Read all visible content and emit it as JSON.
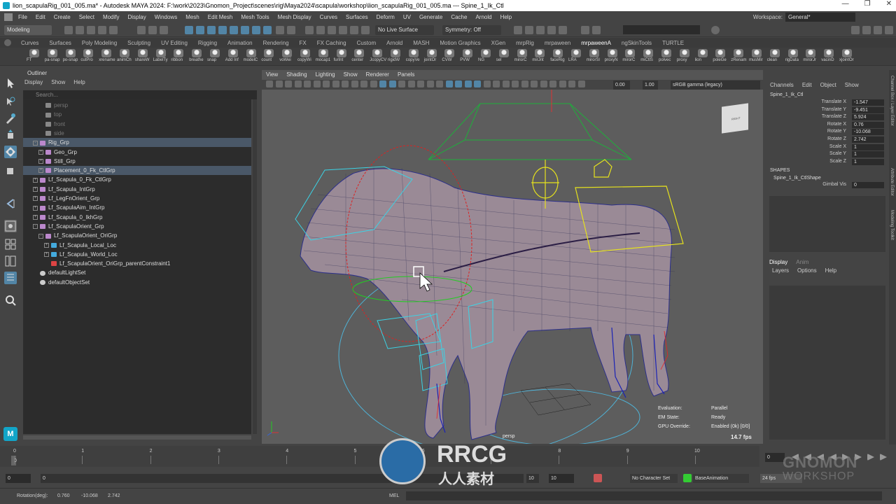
{
  "window": {
    "title": "lion_scapulaRig_001_005.ma* - Autodesk MAYA 2024: F:\\work\\2023\\Gnomon_Project\\scenes\\rig\\Maya2024\\scapula\\workshop\\lion_scapulaRig_001_005.ma  ---  Spine_1_Ik_Ctl",
    "controls": [
      "—",
      "❐",
      "✕"
    ]
  },
  "menubar": {
    "items": [
      "File",
      "Edit",
      "Create",
      "Select",
      "Modify",
      "Display",
      "Windows",
      "Mesh",
      "Edit Mesh",
      "Mesh Tools",
      "Mesh Display",
      "Curves",
      "Surfaces",
      "Deform",
      "UV",
      "Generate",
      "Cache",
      "Arnold",
      "Help"
    ],
    "workspace_label": "Workspace:",
    "workspace_value": "General*"
  },
  "statusline": {
    "mode": "Modeling",
    "live_surface": "No Live Surface",
    "symmetry": "Symmetry: Off"
  },
  "shelf_tabs": [
    "Curves",
    "Surfaces",
    "Poly Modeling",
    "Sculpting",
    "UV Editing",
    "Rigging",
    "Animation",
    "Rendering",
    "FX",
    "FX Caching",
    "Custom",
    "Arnold",
    "MASH",
    "Motion Graphics",
    "XGen",
    "mrpRig",
    "mrpaween",
    "mrpaweenA",
    "ngSkinTools",
    "TURTLE"
  ],
  "shelf_active": "mrpaweenA",
  "shelf_items": [
    "FT",
    "pa-snap",
    "po-snap",
    "cutPro",
    "xrename",
    "animCh",
    "shareW",
    "LabelTy",
    "ribbon",
    "breathe",
    "snap",
    "Add Inf",
    "modelC",
    "count",
    "voWei",
    "copyWi",
    "mocap1",
    "furInt",
    "center",
    "JcopyCV",
    "rigidW",
    "copyVe",
    "jointOr",
    "CVW",
    "PVW",
    "NG",
    "sel",
    "mirorC",
    "mirJnt",
    "faceRig",
    "LRA",
    "mirorSl",
    "proxyN",
    "mirorC",
    "miCtlS",
    "polvec",
    "proxy",
    "lion",
    "poleGe",
    "zRenam",
    "musMir",
    "clean",
    "rigData",
    "mirorJr",
    "vacinD",
    "xjointOr"
  ],
  "outliner": {
    "title": "Outliner",
    "menu": [
      "Display",
      "Show",
      "Help"
    ],
    "search_placeholder": "Search...",
    "rows": [
      {
        "label": "persp",
        "indent": 1,
        "icon": "camera",
        "dim": true
      },
      {
        "label": "top",
        "indent": 1,
        "icon": "camera",
        "dim": true
      },
      {
        "label": "front",
        "indent": 1,
        "icon": "camera",
        "dim": true
      },
      {
        "label": "side",
        "indent": 1,
        "icon": "camera",
        "dim": true
      },
      {
        "label": "Rig_Grp",
        "indent": 0,
        "icon": "group",
        "expand": "-",
        "sel": true
      },
      {
        "label": "Geo_Grp",
        "indent": 1,
        "icon": "group",
        "expand": "+"
      },
      {
        "label": "Still_Grp",
        "indent": 1,
        "icon": "group",
        "expand": "+"
      },
      {
        "label": "Placement_0_Fk_CtlGrp",
        "indent": 1,
        "icon": "group",
        "expand": "+",
        "sel": true
      },
      {
        "label": "Lf_Scapula_0_Fk_CtlGrp",
        "indent": 0,
        "icon": "group",
        "expand": "+"
      },
      {
        "label": "Lf_Scapula_IntGrp",
        "indent": 0,
        "icon": "group",
        "expand": "+"
      },
      {
        "label": "Lf_LegFnOrient_Grp",
        "indent": 0,
        "icon": "group",
        "expand": "+"
      },
      {
        "label": "Lf_ScapulaAim_IntGrp",
        "indent": 0,
        "icon": "group",
        "expand": "+"
      },
      {
        "label": "Lf_Scapula_0_IkhGrp",
        "indent": 0,
        "icon": "group",
        "expand": "+"
      },
      {
        "label": "Lf_ScapulaOrient_Grp",
        "indent": 0,
        "icon": "group",
        "expand": "-"
      },
      {
        "label": "Lf_ScapulaOrient_OriGrp",
        "indent": 1,
        "icon": "group",
        "expand": "-"
      },
      {
        "label": "Lf_Scapula_Local_Loc",
        "indent": 2,
        "icon": "locator",
        "expand": "+"
      },
      {
        "label": "Lf_Scapula_World_Loc",
        "indent": 2,
        "icon": "locator",
        "expand": "+"
      },
      {
        "label": "Lf_ScapulaOrient_OriGrp_parentConstraint1",
        "indent": 2,
        "icon": "constraint"
      },
      {
        "label": "defaultLightSet",
        "indent": 0,
        "icon": "set"
      },
      {
        "label": "defaultObjectSet",
        "indent": 0,
        "icon": "set"
      }
    ]
  },
  "viewport": {
    "menu": [
      "View",
      "Shading",
      "Lighting",
      "Show",
      "Renderer",
      "Panels"
    ],
    "exposure": "0.00",
    "gamma": "1.00",
    "colorspace": "sRGB gamma (legacy)",
    "camera_label": "persp",
    "viewcube_label": "RIGHT",
    "hud": [
      {
        "label": "Evaluation:",
        "value": "Parallel"
      },
      {
        "label": "EM State:",
        "value": "Ready"
      },
      {
        "label": "GPU Override:",
        "value": "Enabled (0k) [0/0]"
      }
    ],
    "fps": "14.7 fps"
  },
  "channel_box": {
    "menu": [
      "Channels",
      "Edit",
      "Object",
      "Show"
    ],
    "node": "Spine_1_Ik_Ctl",
    "attrs": [
      {
        "label": "Translate X",
        "value": "-1.547"
      },
      {
        "label": "Translate Y",
        "value": "-9.451"
      },
      {
        "label": "Translate Z",
        "value": "5.924"
      },
      {
        "label": "Rotate X",
        "value": "0.76"
      },
      {
        "label": "Rotate Y",
        "value": "-10.068"
      },
      {
        "label": "Rotate Z",
        "value": "2.742"
      },
      {
        "label": "Scale X",
        "value": "1"
      },
      {
        "label": "Scale Y",
        "value": "1"
      },
      {
        "label": "Scale Z",
        "value": "1"
      }
    ],
    "shapes_header": "SHAPES",
    "shape_node": "Spine_1_Ik_CtlShape",
    "shape_attr": {
      "label": "Gimbal Vis",
      "value": "0"
    },
    "layer_tabs": [
      "Display",
      "Anim"
    ],
    "layer_menu": [
      "Layers",
      "Options",
      "Help"
    ],
    "side_tabs": [
      "Channel Box / Layer Editor",
      "Attribute Editor",
      "Modeling Toolkit"
    ]
  },
  "timeline": {
    "ticks": [
      "0",
      "1",
      "2",
      "3",
      "4",
      "5",
      "6",
      "7",
      "8",
      "9",
      "10"
    ],
    "current_frame": "0",
    "current_field": "0"
  },
  "range": {
    "start": "0",
    "start_inner": "0",
    "end_inner": "10",
    "end": "10",
    "character_set": "No Character Set",
    "anim_layer": "BaseAnimation",
    "fps": "24 fps"
  },
  "cmdline": {
    "label": "Rotation(deg):",
    "values": [
      "0.760",
      "-10.068",
      "2.742"
    ],
    "lang": "MEL"
  },
  "watermark": {
    "brand": "RRCG",
    "sub": "人人素材",
    "corner1": "GNOMON",
    "corner2": "WORKSHOP"
  },
  "colors": {
    "selection": "#4a5868",
    "accent_blue": "#5285a6",
    "maya_logo": "#12a5c8"
  }
}
